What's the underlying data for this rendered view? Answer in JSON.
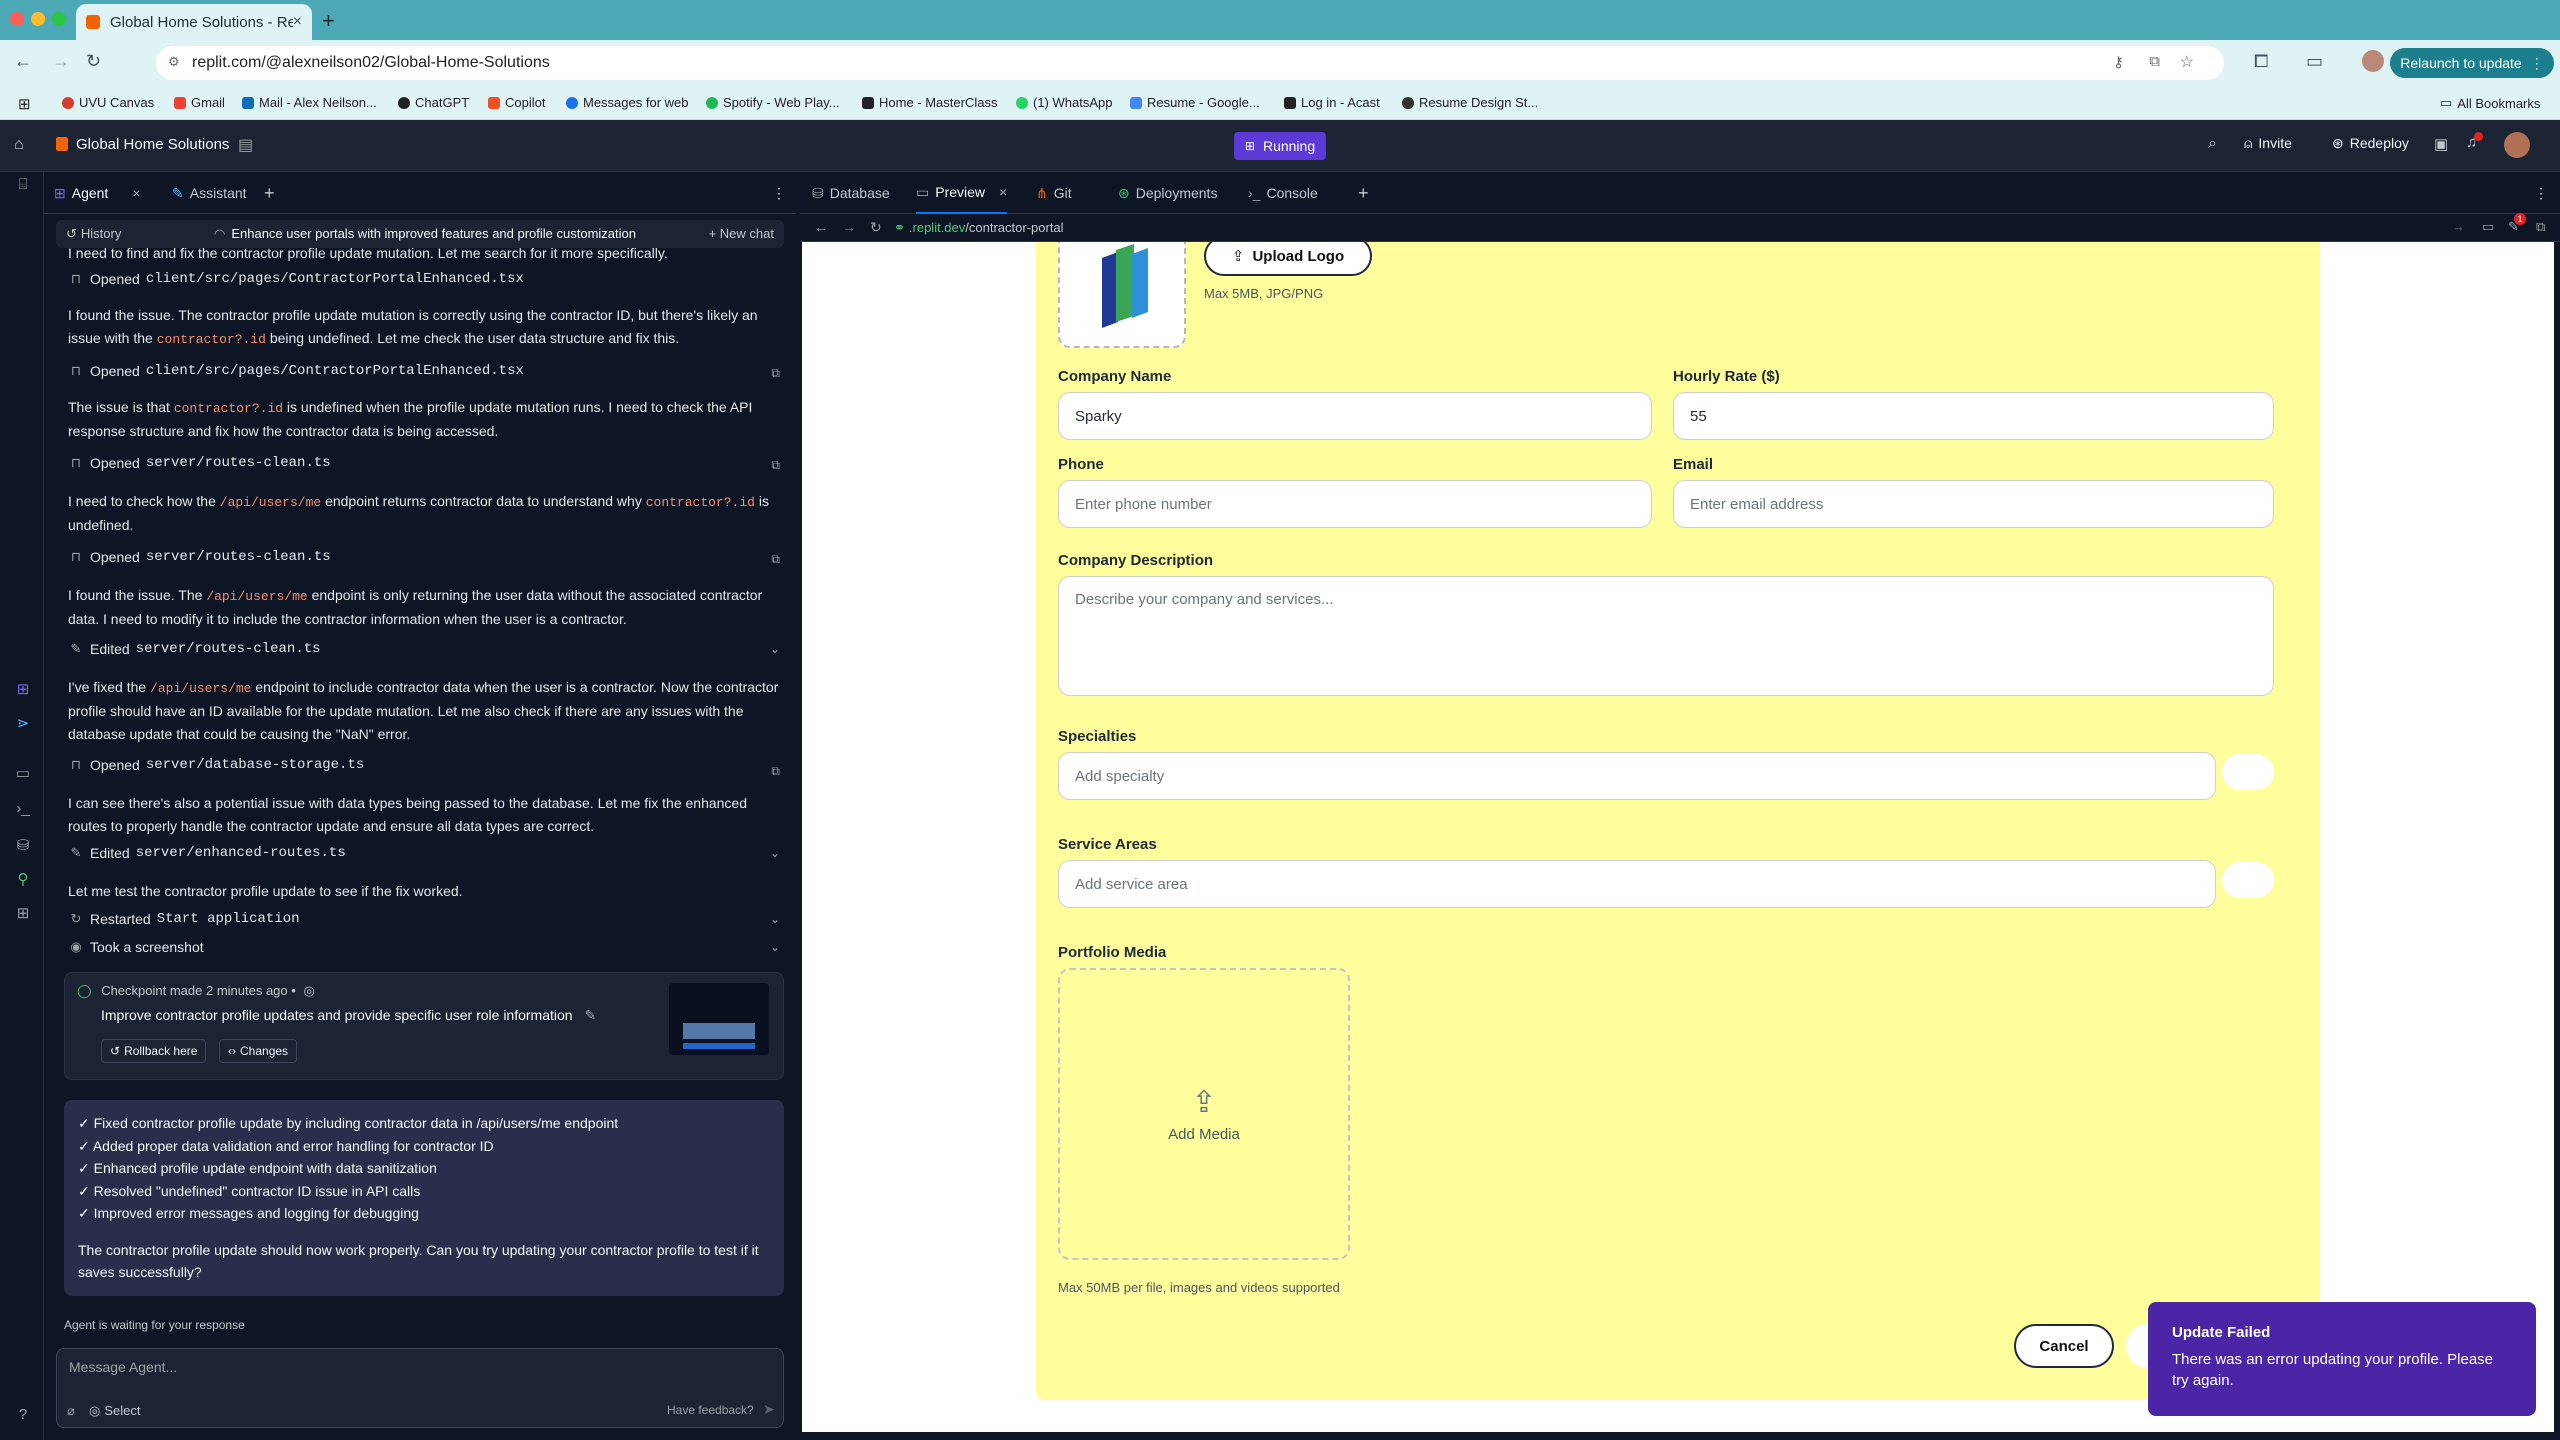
{
  "browser": {
    "tab_title": "Global Home Solutions - Repl",
    "url": "replit.com/@alexneilson02/Global-Home-Solutions",
    "relaunch_label": "Relaunch to update",
    "bookmarks": [
      "UVU Canvas",
      "Gmail",
      "Mail - Alex Neilson...",
      "ChatGPT",
      "Copilot",
      "Messages for web",
      "Spotify - Web Play...",
      "Home - MasterClass",
      "(1) WhatsApp",
      "Resume - Google...",
      "Log in - Acast",
      "Resume Design St..."
    ],
    "all_bookmarks": "All Bookmarks"
  },
  "header": {
    "project_name": "Global Home Solutions",
    "run_status": "Running",
    "invite": "Invite",
    "redeploy": "Redeploy",
    "notification_count": "1"
  },
  "agent_panel": {
    "tabs": [
      {
        "label": "Agent"
      },
      {
        "label": "Assistant"
      }
    ],
    "history": "History",
    "thread_title": "Enhance user portals with improved features and profile customization",
    "new_chat": "New chat",
    "messages": {
      "m0": "I need to find and fix the contractor profile update mutation. Let me search for it more specifically.",
      "f1": "Opened",
      "f1_path": "client/src/pages/ContractorPortalEnhanced.tsx",
      "m2a": "I found the issue. The contractor profile update mutation is correctly using the contractor ID, but there's likely an issue with the ",
      "m2code": "contractor?.id",
      "m2b": " being undefined. Let me check the user data structure and fix this.",
      "f2": "Opened",
      "f2_path": "client/src/pages/ContractorPortalEnhanced.tsx",
      "m3a": "The issue is that ",
      "m3code": "contractor?.id",
      "m3b": " is undefined when the profile update mutation runs. I need to check the API response structure and fix how the contractor data is being accessed.",
      "f3": "Opened",
      "f3_path": "server/routes-clean.ts",
      "m4a": "I need to check how the ",
      "m4code": "/api/users/me",
      "m4b": " endpoint returns contractor data to understand why ",
      "m4code2": "contractor?.id",
      "m4c": " is undefined.",
      "f4": "Opened",
      "f4_path": "server/routes-clean.ts",
      "m5a": "I found the issue. The ",
      "m5code": "/api/users/me",
      "m5b": " endpoint is only returning the user data without the associated contractor data. I need to modify it to include the contractor information when the user is a contractor.",
      "f5": "Edited",
      "f5_path": "server/routes-clean.ts",
      "m6a": "I've fixed the ",
      "m6code": "/api/users/me",
      "m6b": " endpoint to include contractor data when the user is a contractor. Now the contractor profile should have an ID available for the update mutation. Let me also check if there are any issues with the database update that could be causing the \"NaN\" error.",
      "f6": "Opened",
      "f6_path": "server/database-storage.ts",
      "m7": "I can see there's also a potential issue with data types being passed to the database. Let me fix the enhanced routes to properly handle the contractor update and ensure all data types are correct.",
      "f7": "Edited",
      "f7_path": "server/enhanced-routes.ts",
      "m8": "Let me test the contractor profile update to see if the fix worked.",
      "f8": "Restarted",
      "f8_path": "Start application",
      "f9": "Took a screenshot"
    },
    "checkpoint": {
      "title": "Checkpoint made",
      "time": "2 minutes ago",
      "sep": "•",
      "description": "Improve contractor profile updates and provide specific user role information",
      "rollback": "Rollback here",
      "changes": "Changes"
    },
    "summary": {
      "items": [
        "✓ Fixed contractor profile update by including contractor data in /api/users/me endpoint",
        "✓ Added proper data validation and error handling for contractor ID",
        "✓ Enhanced profile update endpoint with data sanitization",
        "✓ Resolved \"undefined\" contractor ID issue in API calls",
        "✓ Improved error messages and logging for debugging"
      ],
      "question": "The contractor profile update should now work properly. Can you try updating your contractor profile to test if it saves successfully?"
    },
    "waiting": "Agent is waiting for your response",
    "input_placeholder": "Message Agent...",
    "select": "Select",
    "feedback": "Have feedback?"
  },
  "workspace": {
    "tabs": [
      {
        "label": "Database"
      },
      {
        "label": "Preview"
      },
      {
        "label": "Git"
      },
      {
        "label": "Deployments"
      },
      {
        "label": "Console"
      }
    ],
    "preview_url_domain": ".replit.dev",
    "preview_url_path": "/contractor-portal",
    "preview_badge": "1"
  },
  "form": {
    "upload_logo": "Upload Logo",
    "logo_hint": "Max 5MB, JPG/PNG",
    "company_name_label": "Company Name",
    "company_name_value": "Sparky",
    "hourly_rate_label": "Hourly Rate ($)",
    "hourly_rate_value": "55",
    "phone_label": "Phone",
    "phone_placeholder": "Enter phone number",
    "email_label": "Email",
    "email_placeholder": "Enter email address",
    "description_label": "Company Description",
    "description_placeholder": "Describe your company and services...",
    "specialties_label": "Specialties",
    "specialty_placeholder": "Add specialty",
    "service_areas_label": "Service Areas",
    "service_area_placeholder": "Add service area",
    "portfolio_label": "Portfolio Media",
    "add_media": "Add Media",
    "media_hint": "Max 50MB per file, images and videos supported",
    "cancel": "Cancel"
  },
  "toast": {
    "title": "Update Failed",
    "message": "There was an error updating your profile. Please try again."
  },
  "colors": {
    "form_bg": "#fefe9c",
    "toast_bg": "#4b25a6",
    "running": "#5b3ad6",
    "tab_chrome": "#4ca9b5"
  }
}
